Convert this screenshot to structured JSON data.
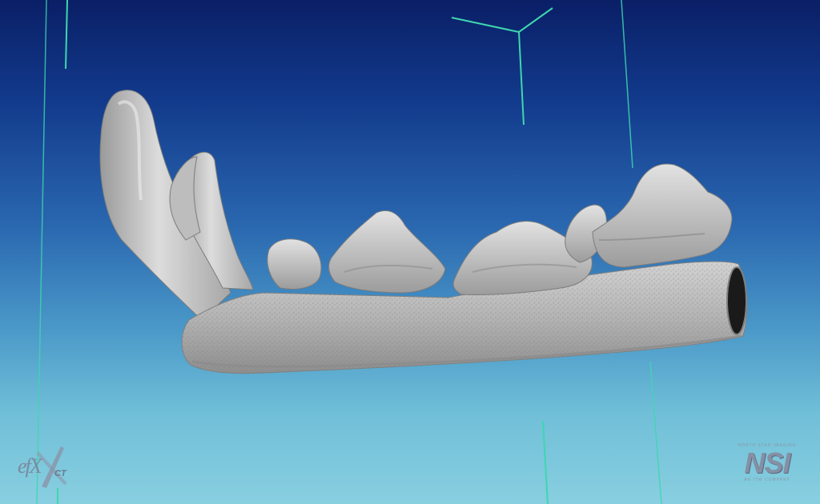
{
  "viewer": {
    "background_top": "#0a1f66",
    "background_bottom": "#88cfe0",
    "axis_color": "#3fd6b0",
    "model_color": "#b9b9b9"
  },
  "scene": {
    "object": "fossil jaw (mandible) 3D surface scan"
  },
  "logos": {
    "efxct_letters": "efX",
    "efxct_suffix": "CT",
    "nsi_top": "NORTH STAR IMAGING",
    "nsi_mark": "NSI",
    "nsi_bottom": "AN ITW COMPANY"
  }
}
